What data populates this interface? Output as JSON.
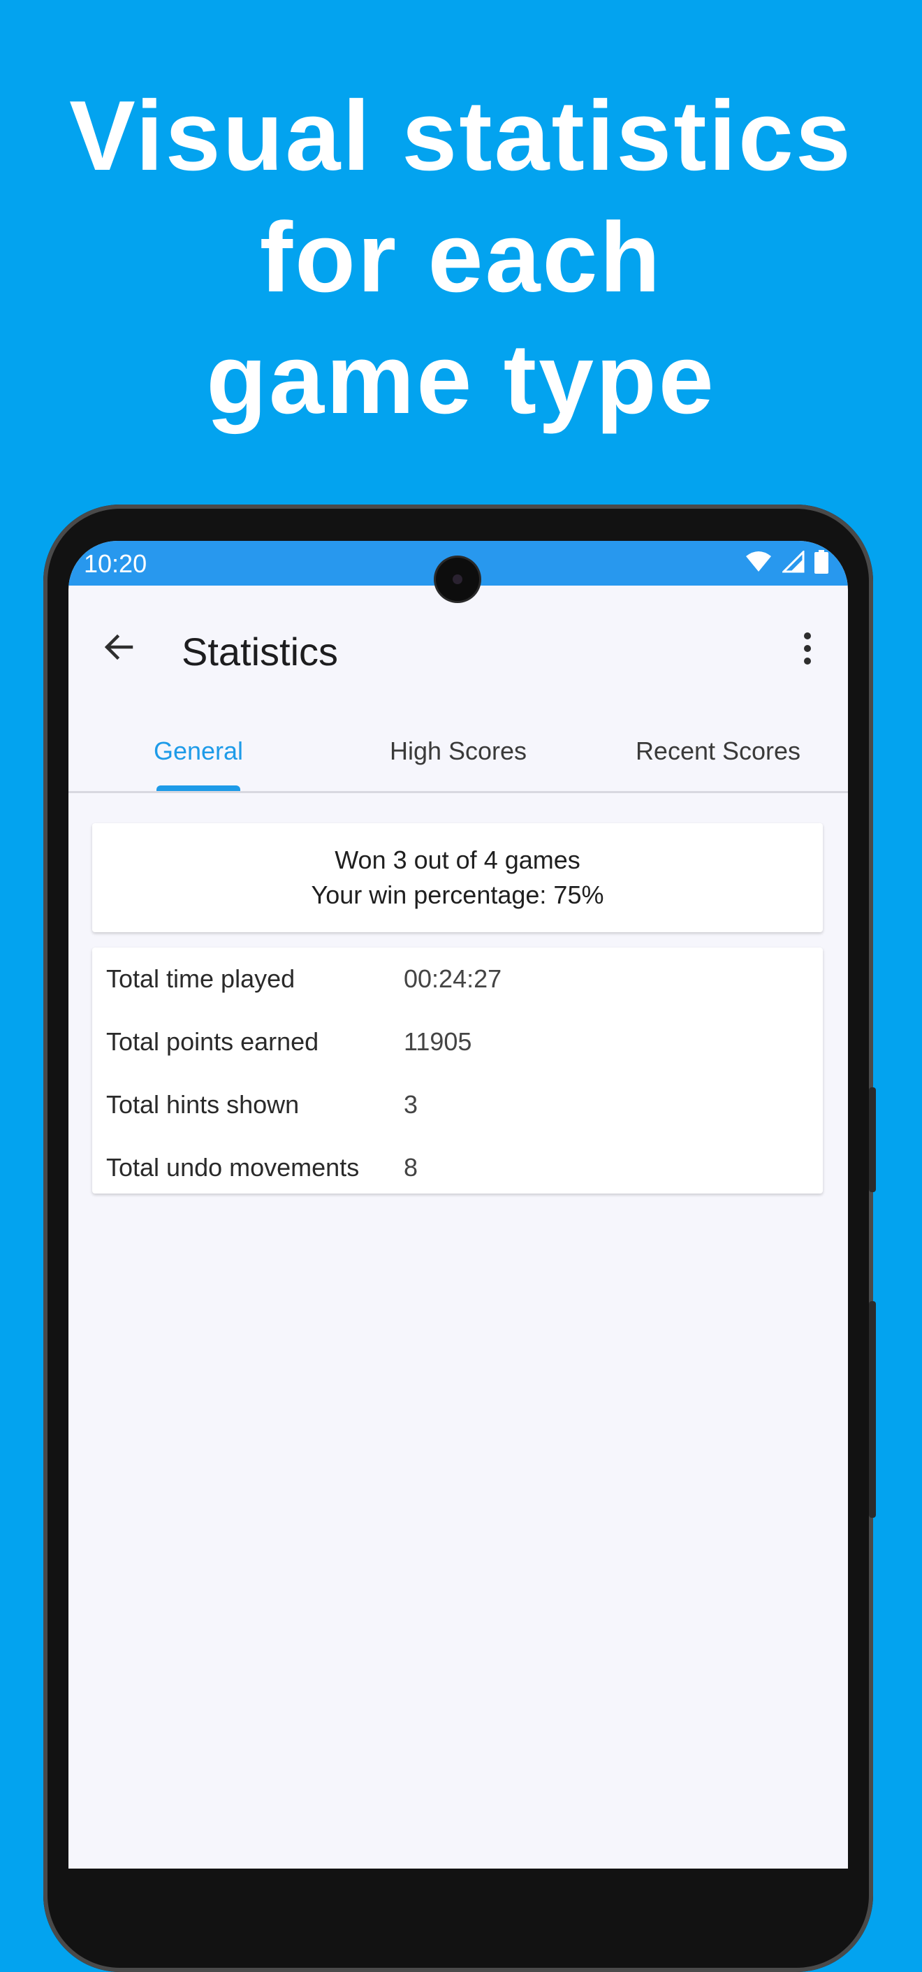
{
  "headline": {
    "lines": [
      "Visual statistics",
      "for each",
      "game type"
    ]
  },
  "status_bar": {
    "time": "10:20",
    "icons": [
      "wifi-icon",
      "signal-icon",
      "battery-icon"
    ]
  },
  "app_bar": {
    "title": "Statistics",
    "back_icon": "arrow-left-icon",
    "menu_icon": "more-vertical-icon"
  },
  "tabs": [
    {
      "label": "General",
      "active": true
    },
    {
      "label": "High Scores",
      "active": false
    },
    {
      "label": "Recent Scores",
      "active": false
    }
  ],
  "summary": {
    "line1": "Won 3 out of 4 games",
    "line2": "Your win percentage: 75%"
  },
  "stats": [
    {
      "label": "Total time played",
      "value": "00:24:27"
    },
    {
      "label": "Total points earned",
      "value": "11905"
    },
    {
      "label": "Total hints shown",
      "value": "3"
    },
    {
      "label": "Total undo movements",
      "value": "8"
    }
  ],
  "colors": {
    "background": "#03a3ef",
    "status_bar": "#2898ee",
    "accent": "#1e9be8",
    "screen_bg": "#f6f6fc"
  }
}
